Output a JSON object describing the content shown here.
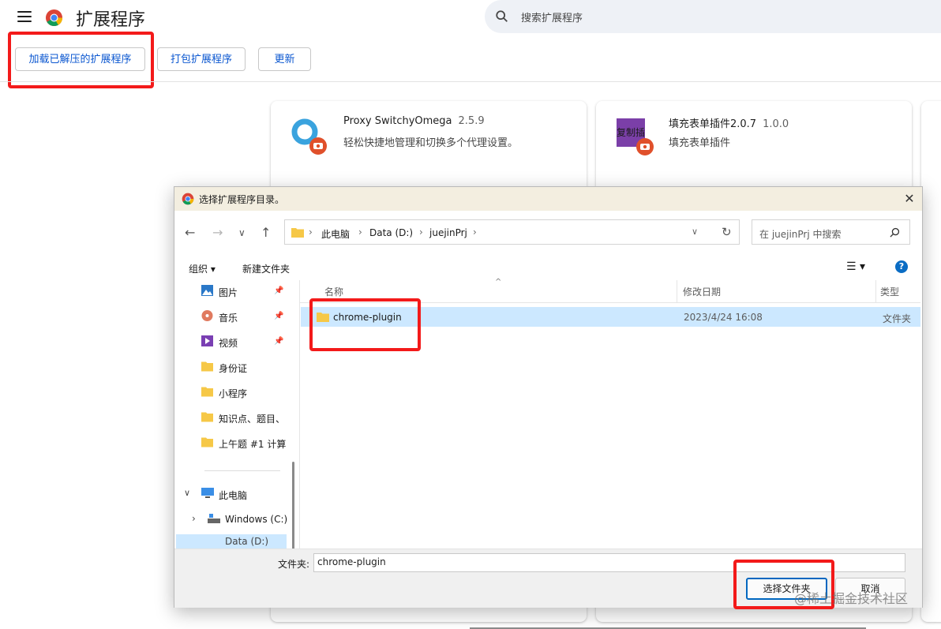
{
  "page": {
    "title": "扩展程序",
    "search_placeholder": "搜索扩展程序",
    "toolbar": {
      "load_unpacked": "加载已解压的扩展程序",
      "pack": "打包扩展程序",
      "update": "更新"
    },
    "extensions": [
      {
        "name": "Proxy SwitchyOmega",
        "version": "2.5.9",
        "description": "轻松快捷地管理和切换多个代理设置。"
      },
      {
        "name": "填充表单插件2.0.7",
        "version": "1.0.0",
        "description": "填充表单插件",
        "icon_text": "复制插件"
      }
    ]
  },
  "dialog": {
    "title": "选择扩展程序目录。",
    "breadcrumb": [
      "此电脑",
      "Data (D:)",
      "juejinPrj"
    ],
    "search_placeholder": "在 juejinPrj 中搜索",
    "organize": "组织",
    "new_folder": "新建文件夹",
    "sidebar": {
      "quick_access": [
        {
          "label": "图片",
          "icon": "pictures-icon",
          "pinned": true
        },
        {
          "label": "音乐",
          "icon": "music-icon",
          "pinned": true
        },
        {
          "label": "视频",
          "icon": "video-icon",
          "pinned": true
        },
        {
          "label": "身份证",
          "icon": "folder-icon"
        },
        {
          "label": "小程序",
          "icon": "folder-icon"
        },
        {
          "label": "知识点、题目、",
          "icon": "folder-icon"
        },
        {
          "label": "上午题 #1 计算",
          "icon": "folder-icon"
        }
      ],
      "this_pc": "此电脑",
      "drive_c": "Windows (C:)",
      "drive_d_partial": "Data (D:)"
    },
    "columns": {
      "name": "名称",
      "date": "修改日期",
      "type": "类型"
    },
    "files": [
      {
        "name": "chrome-plugin",
        "date": "2023/4/24 16:08",
        "type": "文件夹"
      }
    ],
    "folder_label": "文件夹:",
    "folder_value": "chrome-plugin",
    "select_button": "选择文件夹",
    "cancel_button": "取消"
  },
  "watermark": "@稀土掘金技术社区",
  "colors": {
    "highlight": "#f31a1a",
    "accent": "#0b57d0",
    "selection": "#cce8ff"
  }
}
